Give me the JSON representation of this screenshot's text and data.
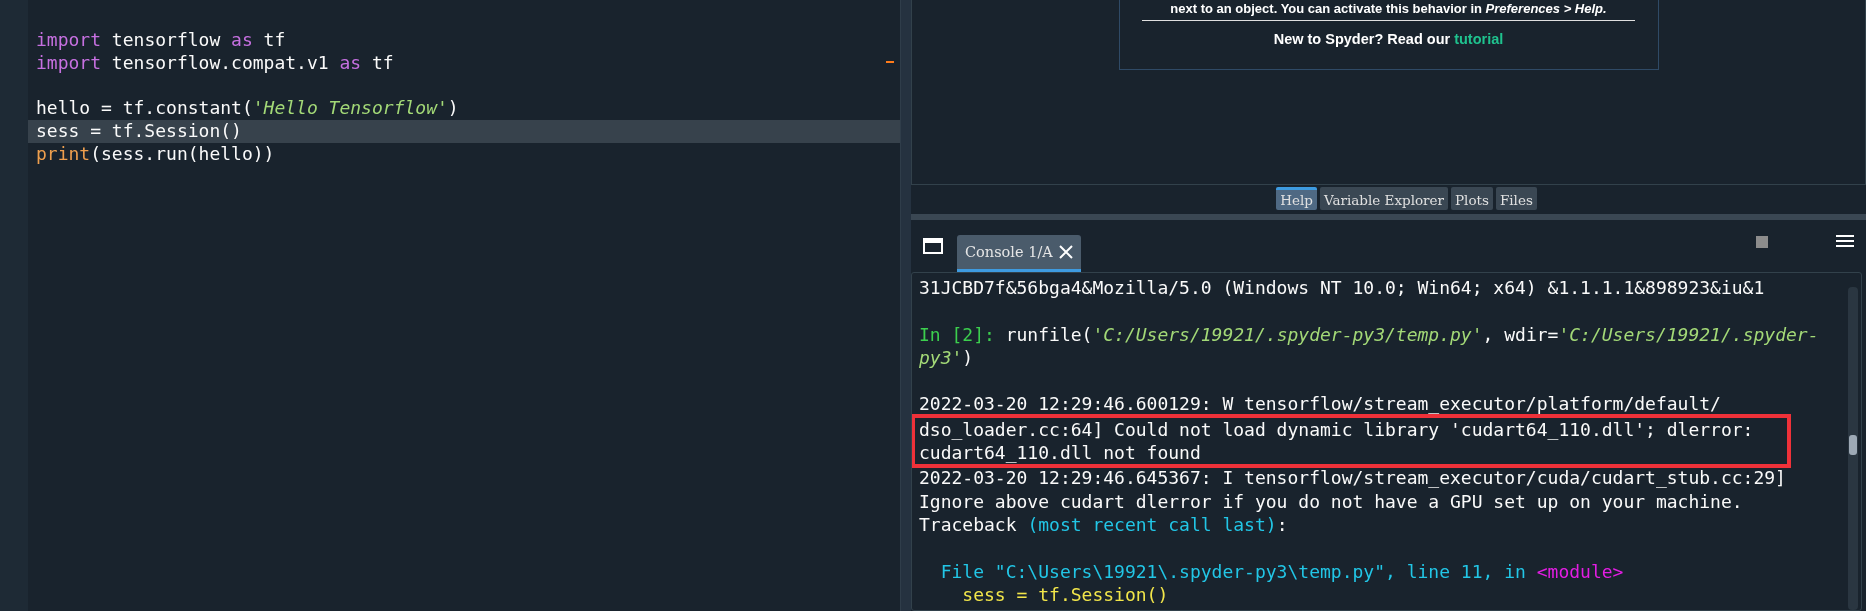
{
  "editor": {
    "lines": [
      {
        "kind": "code",
        "current": false,
        "segments": [
          {
            "text": "import",
            "kind": "keyword"
          },
          {
            "text": " tensorflow ",
            "kind": "plain"
          },
          {
            "text": "as",
            "kind": "keyword"
          },
          {
            "text": " tf",
            "kind": "plain"
          }
        ]
      },
      {
        "kind": "code",
        "current": false,
        "segments": [
          {
            "text": "import",
            "kind": "keyword"
          },
          {
            "text": " tensorflow.compat.v1 ",
            "kind": "plain"
          },
          {
            "text": "as",
            "kind": "keyword"
          },
          {
            "text": " tf",
            "kind": "plain"
          }
        ]
      },
      {
        "kind": "blank"
      },
      {
        "kind": "code",
        "current": false,
        "segments": [
          {
            "text": "hello = tf.constant(",
            "kind": "plain"
          },
          {
            "text": "'Hello Tensorflow'",
            "kind": "string"
          },
          {
            "text": ")",
            "kind": "plain"
          }
        ]
      },
      {
        "kind": "code",
        "current": true,
        "segments": [
          {
            "text": "sess = tf.Session()",
            "kind": "plain"
          }
        ]
      },
      {
        "kind": "code",
        "current": false,
        "segments": [
          {
            "text": "print",
            "kind": "builtin"
          },
          {
            "text": "(sess.run(hello))",
            "kind": "plain"
          }
        ]
      }
    ]
  },
  "help": {
    "note": "next to an object. You can activate this behavior in *Preferences > Help.*",
    "intro": "New to Spyder? Read our",
    "link": "tutorial"
  },
  "pane_tabs": [
    {
      "label": "Help",
      "selected": true
    },
    {
      "label": "Variable Explorer",
      "selected": false
    },
    {
      "label": "Plots",
      "selected": false
    },
    {
      "label": "Files",
      "selected": false
    }
  ],
  "console": {
    "tab": {
      "label": "Console 1/A",
      "selected": true
    },
    "blocks": [
      {
        "kind": "output",
        "highlighted": false,
        "lines": [
          [
            {
              "text": "31JCBD7f&56bga4&Mozilla/5.0 (Windows NT 10.0; Win64; x64) &1.1.1.1&898923&iu&1",
              "kind": "plain"
            }
          ]
        ]
      },
      {
        "kind": "blank"
      },
      {
        "kind": "output",
        "highlighted": false,
        "lines": [
          [
            {
              "text": "In [2]:",
              "kind": "prompt"
            },
            {
              "text": " runfile(",
              "kind": "plain"
            },
            {
              "text": "'C:/Users/19921/.spyder-py3/temp.py'",
              "kind": "string"
            },
            {
              "text": ", wdir=",
              "kind": "plain"
            },
            {
              "text": "'C:/Users/19921/.spyder-",
              "kind": "string"
            }
          ],
          [
            {
              "text": "py3'",
              "kind": "string"
            },
            {
              "text": ")",
              "kind": "plain"
            }
          ]
        ]
      },
      {
        "kind": "blank"
      },
      {
        "kind": "output",
        "highlighted": false,
        "lines": [
          [
            {
              "text": "2022-03-20 12:29:46.600129: W tensorflow/stream_executor/platform/default/",
              "kind": "plain"
            }
          ]
        ]
      },
      {
        "kind": "output",
        "highlighted": true,
        "lines": [
          [
            {
              "text": "dso_loader.cc:64] Could not load dynamic library 'cudart64_110.dll'; dlerror:",
              "kind": "plain"
            }
          ],
          [
            {
              "text": "cudart64_110.dll not found",
              "kind": "plain"
            }
          ]
        ]
      },
      {
        "kind": "output",
        "highlighted": false,
        "lines": [
          [
            {
              "text": "2022-03-20 12:29:46.645367: I tensorflow/stream_executor/cuda/cudart_stub.cc:29]",
              "kind": "plain"
            }
          ],
          [
            {
              "text": "Ignore above cudart dlerror if you do not have a GPU set up on your machine.",
              "kind": "plain"
            }
          ],
          [
            {
              "text": "Traceback ",
              "kind": "plain"
            },
            {
              "text": "(most recent call last)",
              "kind": "cyan"
            },
            {
              "text": ":",
              "kind": "plain"
            }
          ]
        ]
      },
      {
        "kind": "blank"
      },
      {
        "kind": "output",
        "highlighted": false,
        "lines": [
          [
            {
              "text": "  File \"C:\\Users\\19921\\.spyder-py3\\temp.py\", line 11, in ",
              "kind": "cyan"
            },
            {
              "text": "<module>",
              "kind": "magenta"
            }
          ],
          [
            {
              "text": "    sess = tf.Session()",
              "kind": "yellow"
            }
          ]
        ]
      }
    ]
  }
}
